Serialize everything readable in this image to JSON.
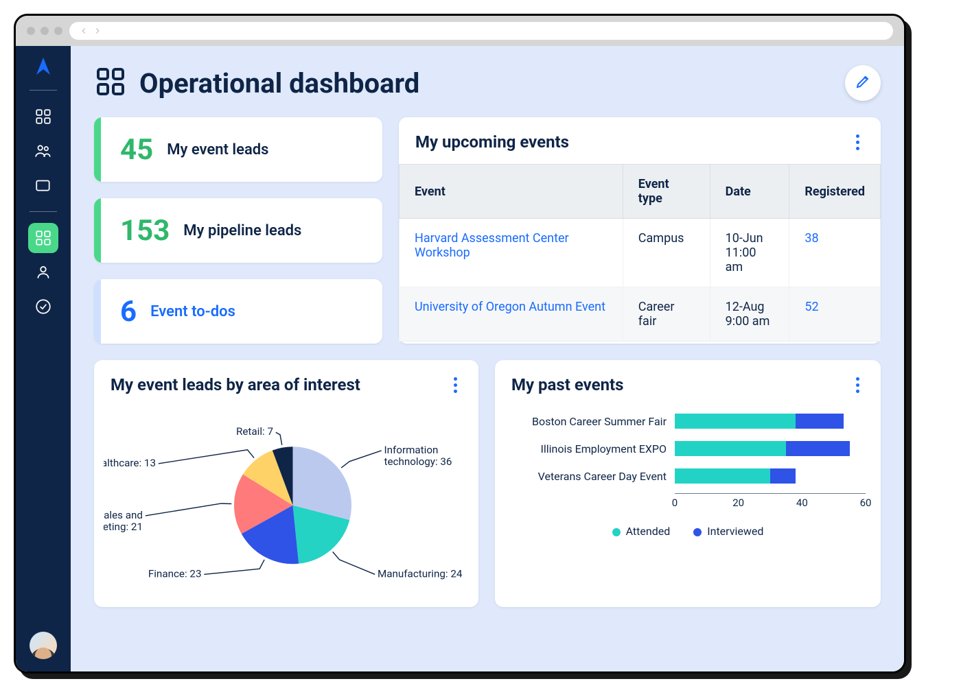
{
  "header": {
    "title": "Operational dashboard"
  },
  "kpis": [
    {
      "value": "45",
      "label": "My event leads",
      "tone": "green"
    },
    {
      "value": "153",
      "label": "My pipeline leads",
      "tone": "green"
    },
    {
      "value": "6",
      "label": "Event to-dos",
      "tone": "blue"
    }
  ],
  "upcoming": {
    "title": "My upcoming events",
    "columns": [
      "Event",
      "Event type",
      "Date",
      "Registered"
    ],
    "rows": [
      {
        "event": "Harvard Assessment Center Workshop",
        "type": "Campus",
        "date": "10-Jun 11:00 am",
        "registered": "38"
      },
      {
        "event": "University of Oregon Autumn Event",
        "type": "Career fair",
        "date": "12-Aug 9:00 am",
        "registered": "52"
      }
    ]
  },
  "pie_panel": {
    "title": "My event leads by area of interest"
  },
  "bars_panel": {
    "title": "My past events"
  },
  "legend": {
    "attended": "Attended",
    "interviewed": "Interviewed"
  },
  "chart_data": [
    {
      "type": "pie",
      "title": "My event leads by area of interest",
      "slices": [
        {
          "label": "Information technology",
          "value": 36,
          "color": "#bcc9ef"
        },
        {
          "label": "Manufacturing",
          "value": 24,
          "color": "#24d3c4"
        },
        {
          "label": "Finance",
          "value": 23,
          "color": "#2f53e7"
        },
        {
          "label": "Sales and marketing",
          "value": 21,
          "color": "#ff7a7a"
        },
        {
          "label": "Healthcare",
          "value": 13,
          "color": "#ffd268"
        },
        {
          "label": "Retail",
          "value": 7,
          "color": "#0f2547"
        }
      ]
    },
    {
      "type": "bar",
      "orientation": "horizontal-stacked",
      "title": "My past events",
      "categories": [
        "Boston Career Summer Fair",
        "Illinois Employment EXPO",
        "Veterans Career Day Event"
      ],
      "series": [
        {
          "name": "Attended",
          "color": "#22d3c5",
          "values": [
            38,
            35,
            30
          ]
        },
        {
          "name": "Interviewed",
          "color": "#2f53e7",
          "values": [
            15,
            20,
            8
          ]
        }
      ],
      "xlabel": "",
      "ylabel": "",
      "xlim": [
        0,
        60
      ],
      "xticks": [
        0,
        20,
        40,
        60
      ]
    }
  ]
}
